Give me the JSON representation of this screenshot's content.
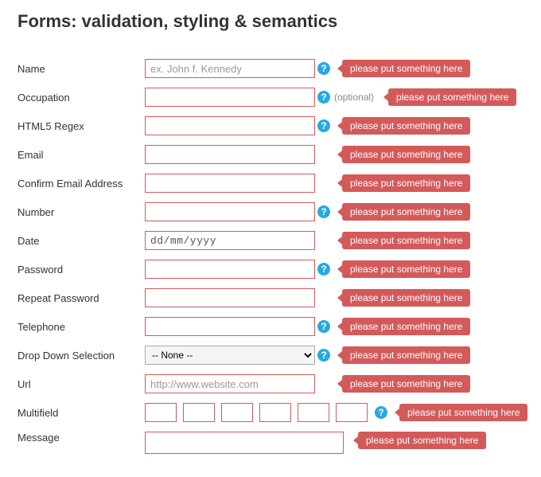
{
  "title": "Forms: validation, styling & semantics",
  "error_text": "please put something here",
  "optional_text": "(optional)",
  "help_glyph": "?",
  "fields": {
    "name": {
      "label": "Name",
      "placeholder": "ex. John f. Kennedy",
      "value": ""
    },
    "occupation": {
      "label": "Occupation",
      "placeholder": "",
      "value": ""
    },
    "regex": {
      "label": "HTML5 Regex",
      "placeholder": "",
      "value": ""
    },
    "email": {
      "label": "Email",
      "placeholder": "",
      "value": ""
    },
    "confirm_email": {
      "label": "Confirm Email Address",
      "placeholder": "",
      "value": ""
    },
    "number": {
      "label": "Number",
      "placeholder": "",
      "value": ""
    },
    "date": {
      "label": "Date",
      "placeholder": "",
      "value": "dd/mm/yyyy"
    },
    "password": {
      "label": "Password",
      "placeholder": "",
      "value": ""
    },
    "repeat_password": {
      "label": "Repeat Password",
      "placeholder": "",
      "value": ""
    },
    "telephone": {
      "label": "Telephone",
      "placeholder": "",
      "value": ""
    },
    "dropdown": {
      "label": "Drop Down Selection",
      "selected": "-- None --"
    },
    "url": {
      "label": "Url",
      "placeholder": "http://www.website.com",
      "value": ""
    },
    "multifield": {
      "label": "Multifield"
    },
    "message": {
      "label": "Message",
      "value": ""
    }
  }
}
